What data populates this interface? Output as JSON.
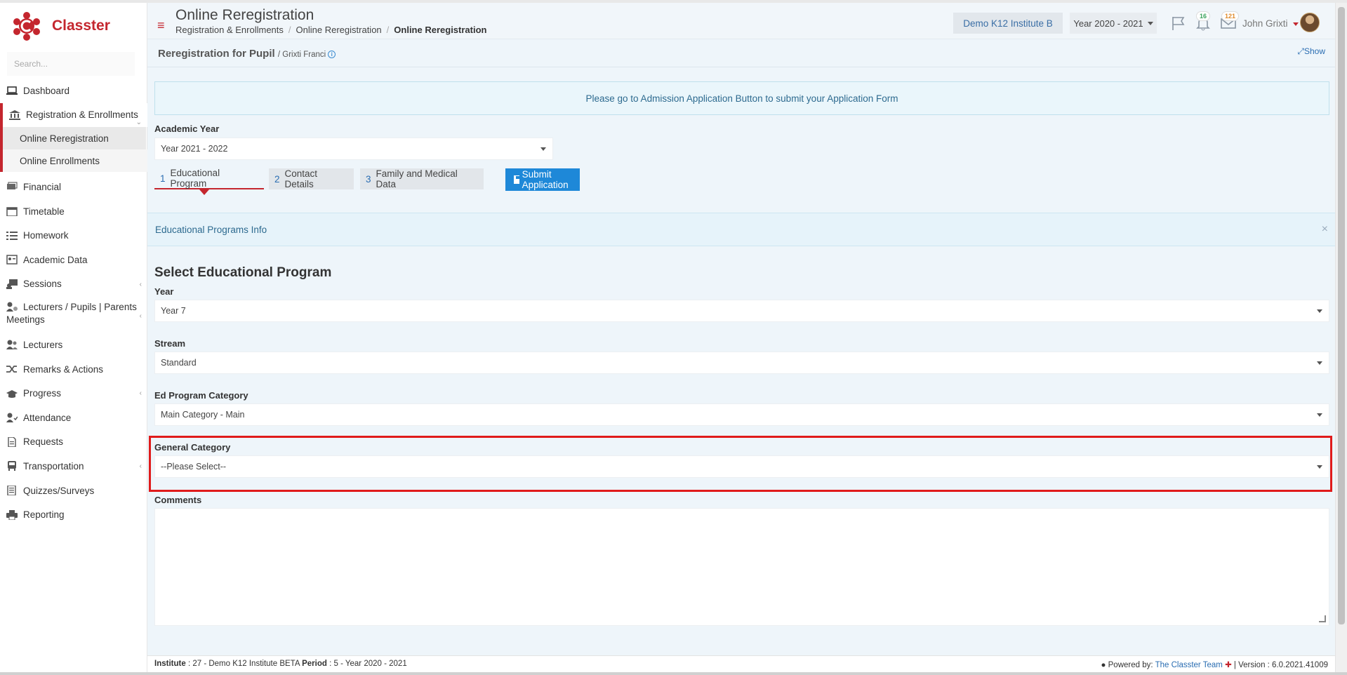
{
  "app": {
    "name": "Classter",
    "brand_color": "#c4262e",
    "accent_color": "#1e88d8"
  },
  "sidebar": {
    "search_placeholder": "Search...",
    "items": [
      {
        "label": "Dashboard",
        "icon": "laptop-icon"
      },
      {
        "label": "Registration & Enrollments",
        "icon": "bank-icon",
        "sub": [
          "Online Reregistration",
          "Online Enrollments"
        ]
      },
      {
        "label": "Financial",
        "icon": "money-icon"
      },
      {
        "label": "Timetable",
        "icon": "calendar-icon"
      },
      {
        "label": "Homework",
        "icon": "list-icon"
      },
      {
        "label": "Academic Data",
        "icon": "id-card-icon"
      },
      {
        "label": "Sessions",
        "icon": "sessions-icon"
      },
      {
        "label": "Lecturers / Pupils | Parents Meetings",
        "icon": "meeting-icon"
      },
      {
        "label": "Lecturers",
        "icon": "users-icon"
      },
      {
        "label": "Remarks & Actions",
        "icon": "random-icon"
      },
      {
        "label": "Progress",
        "icon": "graduation-cap-icon"
      },
      {
        "label": "Attendance",
        "icon": "user-check-icon"
      },
      {
        "label": "Requests",
        "icon": "file-icon"
      },
      {
        "label": "Transportation",
        "icon": "bus-icon"
      },
      {
        "label": "Quizzes/Surveys",
        "icon": "checklist-icon"
      },
      {
        "label": "Reporting",
        "icon": "print-icon"
      }
    ]
  },
  "header": {
    "title": "Online Reregistration",
    "breadcrumb": [
      "Registration & Enrollments",
      "Online Reregistration",
      "Online Reregistration"
    ],
    "institute_button": "Demo K12 Institute B",
    "year_button": "Year 2020 - 2021",
    "notifications_count": "16",
    "messages_count": "121",
    "user_name": "John Grixti"
  },
  "main": {
    "title": "Reregistration for Pupil",
    "pupil": "/ Grixti Franci",
    "show_link": "Show",
    "notice": "Please go to Admission Application Button to submit your Application Form",
    "academic_year": {
      "label": "Academic Year",
      "value": "Year 2021 - 2022"
    },
    "tabs": [
      {
        "num": "1",
        "label": "Educational Program"
      },
      {
        "num": "2",
        "label": "Contact Details"
      },
      {
        "num": "3",
        "label": "Family and Medical Data"
      }
    ],
    "submit_button": "Submit Application",
    "info_panel": "Educational Programs Info",
    "section_title": "Select Educational Program",
    "fields": {
      "year": {
        "label": "Year",
        "value": "Year 7"
      },
      "stream": {
        "label": "Stream",
        "value": "Standard"
      },
      "ed_program_category": {
        "label": "Ed Program Category",
        "value": "Main Category - Main"
      },
      "general_category": {
        "label": "General Category",
        "value": "--Please Select--"
      },
      "comments": {
        "label": "Comments",
        "value": ""
      }
    }
  },
  "footer": {
    "institute_label": "Institute",
    "institute_value": ": 27 - Demo K12 Institute BETA",
    "period_label": "Period",
    "period_value": ": 5 - Year 2020 - 2021",
    "powered_by": "Powered by:",
    "team_link": "The Classter Team",
    "version": "| Version : 6.0.2021.41009"
  }
}
